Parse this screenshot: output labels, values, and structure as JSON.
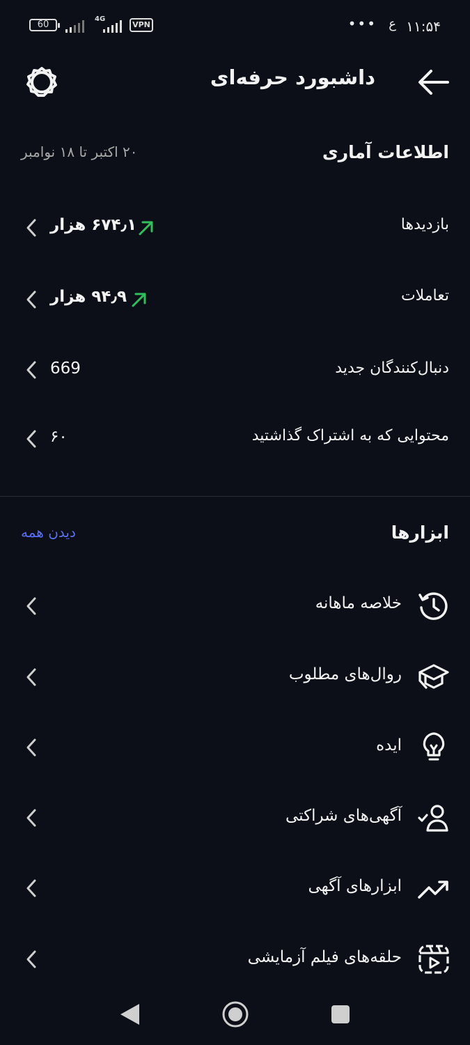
{
  "status_bar": {
    "battery": "60",
    "network": "4G",
    "vpn": "VPN",
    "time": "۱۱:۵۴",
    "dots": "•••",
    "status_glyph": "ع"
  },
  "header": {
    "title": "داشبورد حرفه‌ای"
  },
  "stats": {
    "heading": "اطلاعات آماری",
    "date_range": "۲۰ اکتبر تا ۱۸ نوامبر",
    "rows": [
      {
        "label": "بازدیدها",
        "value": "۶۷۴٫۱ هزار",
        "trend": "up"
      },
      {
        "label": "تعاملات",
        "value": "۹۴٫۹ هزار",
        "trend": "up"
      },
      {
        "label": "دنبال‌کنندگان جدید",
        "value": "669"
      },
      {
        "label": "محتوایی که به اشتراک گذاشتید",
        "value": "۶۰"
      }
    ]
  },
  "tools": {
    "heading": "ابزارها",
    "see_all": "دیدن همه",
    "items": [
      {
        "label": "خلاصه ماهانه",
        "icon": "history-icon"
      },
      {
        "label": "روال‌های مطلوب",
        "icon": "graduation-cap-icon"
      },
      {
        "label": "ایده",
        "icon": "lightbulb-icon"
      },
      {
        "label": "آگهی‌های شراکتی",
        "icon": "user-check-icon"
      },
      {
        "label": "ابزارهای آگهی",
        "icon": "trending-up-icon"
      },
      {
        "label": "حلقه‌های فیلم آزمایشی",
        "icon": "reel-icon"
      }
    ]
  },
  "colors": {
    "background": "#0c0f17",
    "accent_link": "#5a6ff0",
    "trend_up": "#2fbf5b"
  }
}
